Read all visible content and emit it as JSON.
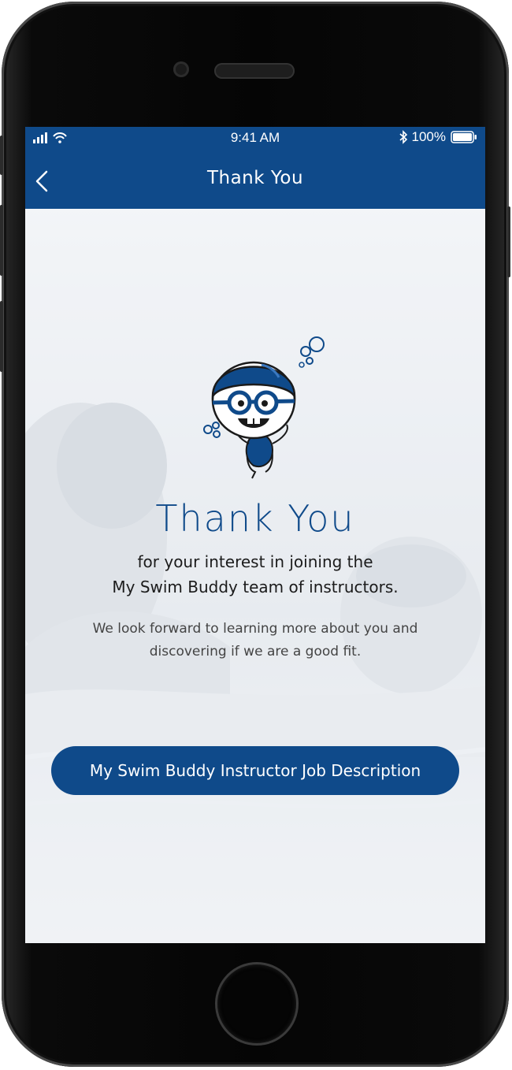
{
  "status_bar": {
    "time": "9:41 AM",
    "battery_percent": "100%",
    "signal_icon": "cellular-signal-icon",
    "wifi_icon": "wifi-icon",
    "bluetooth_icon": "bluetooth-icon",
    "battery_icon": "battery-icon",
    "battery_level": 1.0
  },
  "nav_bar": {
    "title": "Thank You",
    "back_icon": "chevron-left-icon"
  },
  "content": {
    "heading": "Thank You",
    "subtitle_line1": "for your interest in joining the",
    "subtitle_line2": "My Swim Buddy team of instructors.",
    "body_line1": "We look forward to learning more about you and",
    "body_line2": "discovering if we are a good fit.",
    "button_label": "My Swim Buddy Instructor Job Description"
  },
  "colors": {
    "brand_blue": "#0f4a8a",
    "screen_background": "#f3f5f8",
    "text_dark": "#1b1b1b",
    "text_muted": "#444444"
  }
}
